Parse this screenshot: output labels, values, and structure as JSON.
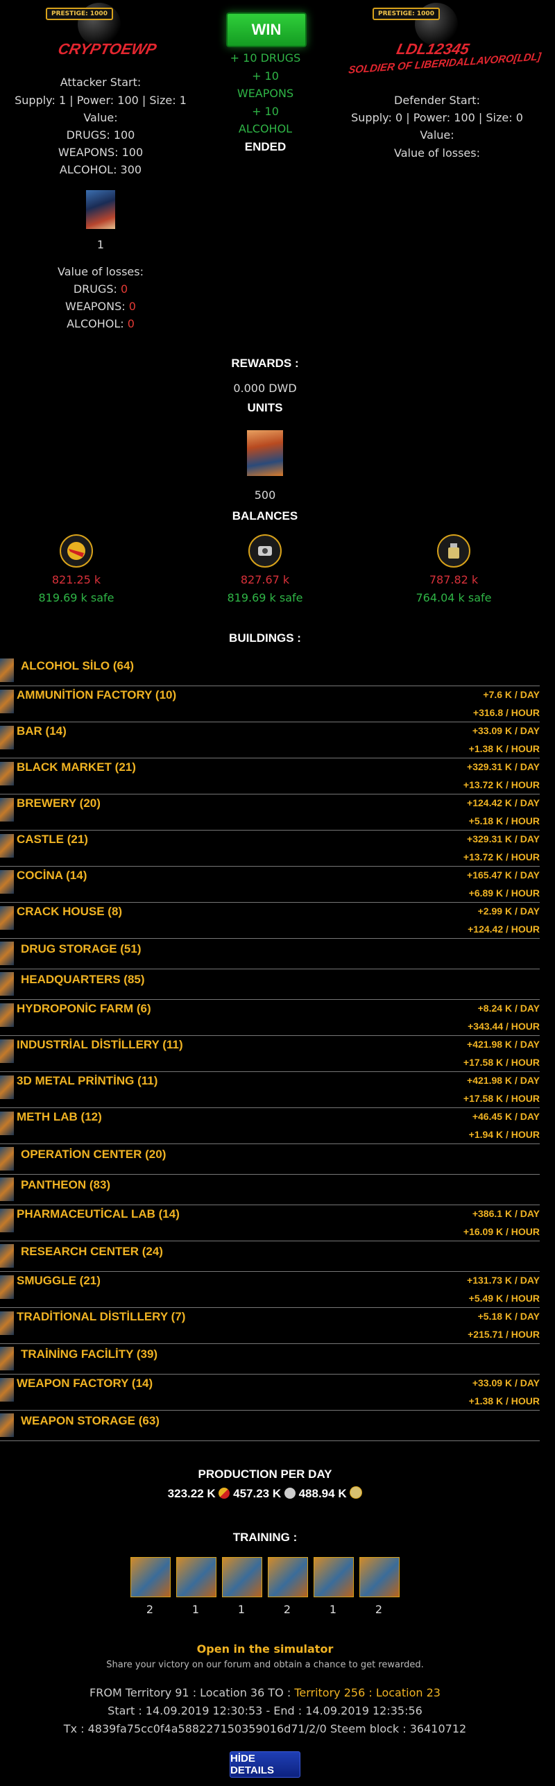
{
  "attacker": {
    "prestige": "PRESTIGE: 1000",
    "name": "CRYPTOEWP",
    "start_label": "Attacker Start:",
    "stats": "Supply: 1 | Power: 100 | Size: 1",
    "value_label": "Value:",
    "drugs": "DRUGS: 100",
    "weapons": "WEAPONS: 100",
    "alcohol": "ALCOHOL: 300",
    "unit_count": "1",
    "losses_label": "Value of losses:",
    "loss_drugs_label": "DRUGS:",
    "loss_drugs": "0",
    "loss_weapons_label": "WEAPONS:",
    "loss_weapons": "0",
    "loss_alcohol_label": "ALCOHOL:",
    "loss_alcohol": "0"
  },
  "result": {
    "win_label": "WIN",
    "line1": "+ 10 DRUGS",
    "line2": "+ 10",
    "line3": "WEAPONS",
    "line4": "+ 10",
    "line5": "ALCOHOL",
    "status": "ENDED"
  },
  "defender": {
    "prestige": "PRESTIGE: 1000",
    "name": "LDL12345",
    "subtitle": "SOLDIER OF LIBERIDALLAVORO[LDL]",
    "start_label": "Defender Start:",
    "stats": "Supply: 0 | Power: 100 | Size: 0",
    "value_label": "Value:",
    "losses_label": "Value of losses:"
  },
  "rewards": {
    "title": "REWARDS :",
    "dwd": "0.000 DWD",
    "units_title": "UNITS",
    "unit_count": "500",
    "balances_title": "BALANCES",
    "balances": [
      {
        "icon": "drugs-icon",
        "value": "821.25 k",
        "safe": "819.69 k safe"
      },
      {
        "icon": "weapons-icon",
        "value": "827.67 k",
        "safe": "819.69 k safe"
      },
      {
        "icon": "alcohol-icon",
        "value": "787.82 k",
        "safe": "764.04 k safe"
      }
    ]
  },
  "buildings": {
    "title": "BUILDINGS :",
    "items": [
      {
        "name": "ALCOHOL SİLO (64)",
        "day": "",
        "hour": ""
      },
      {
        "name": "AMMUNİTİON FACTORY (10)",
        "day": "+7.6 K / DAY",
        "hour": "+316.8 / HOUR"
      },
      {
        "name": "BAR (14)",
        "day": "+33.09 K / DAY",
        "hour": "+1.38 K / HOUR"
      },
      {
        "name": "BLACK MARKET (21)",
        "day": "+329.31 K / DAY",
        "hour": "+13.72 K / HOUR"
      },
      {
        "name": "BREWERY (20)",
        "day": "+124.42 K / DAY",
        "hour": "+5.18 K / HOUR"
      },
      {
        "name": "CASTLE (21)",
        "day": "+329.31 K / DAY",
        "hour": "+13.72 K / HOUR"
      },
      {
        "name": "COCİNA (14)",
        "day": "+165.47 K / DAY",
        "hour": "+6.89 K / HOUR"
      },
      {
        "name": "CRACK HOUSE (8)",
        "day": "+2.99 K / DAY",
        "hour": "+124.42 / HOUR"
      },
      {
        "name": "DRUG STORAGE (51)",
        "day": "",
        "hour": ""
      },
      {
        "name": "HEADQUARTERS (85)",
        "day": "",
        "hour": ""
      },
      {
        "name": "HYDROPONİC FARM (6)",
        "day": "+8.24 K / DAY",
        "hour": "+343.44 / HOUR"
      },
      {
        "name": "INDUSTRİAL DİSTİLLERY (11)",
        "day": "+421.98 K / DAY",
        "hour": "+17.58 K / HOUR"
      },
      {
        "name": "3D METAL PRİNTİNG (11)",
        "day": "+421.98 K / DAY",
        "hour": "+17.58 K / HOUR"
      },
      {
        "name": "METH LAB (12)",
        "day": "+46.45 K / DAY",
        "hour": "+1.94 K / HOUR"
      },
      {
        "name": "OPERATİON CENTER (20)",
        "day": "",
        "hour": ""
      },
      {
        "name": "PANTHEON (83)",
        "day": "",
        "hour": ""
      },
      {
        "name": "PHARMACEUTİCAL LAB (14)",
        "day": "+386.1 K / DAY",
        "hour": "+16.09 K / HOUR"
      },
      {
        "name": "RESEARCH CENTER (24)",
        "day": "",
        "hour": ""
      },
      {
        "name": "SMUGGLE (21)",
        "day": "+131.73 K / DAY",
        "hour": "+5.49 K / HOUR"
      },
      {
        "name": "TRADİTİONAL DİSTİLLERY (7)",
        "day": "+5.18 K / DAY",
        "hour": "+215.71 / HOUR"
      },
      {
        "name": "TRAİNİNG FACİLİTY (39)",
        "day": "",
        "hour": ""
      },
      {
        "name": "WEAPON FACTORY (14)",
        "day": "+33.09 K / DAY",
        "hour": "+1.38 K / HOUR"
      },
      {
        "name": "WEAPON STORAGE (63)",
        "day": "",
        "hour": ""
      }
    ]
  },
  "production": {
    "title": "PRODUCTION PER DAY",
    "drugs": "323.22 K",
    "weapons": "457.23 K",
    "alcohol": "488.94 K"
  },
  "training": {
    "title": "TRAINING :",
    "counts": [
      "2",
      "1",
      "1",
      "2",
      "1",
      "2"
    ]
  },
  "footer": {
    "simulator_link": "Open in the simulator",
    "share_text": "Share your victory on our forum and obtain a chance to get rewarded.",
    "from_text": "FROM Territory 91 : Location 36 TO :",
    "to_text": "Territory 256 : Location 23",
    "times": "Start : 14.09.2019 12:30:53 - End : 14.09.2019 12:35:56",
    "tx": "Tx : 4839fa75cc0f4a588227150359016d71/2/0 Steem block : 36410712",
    "hide_button": "HİDE DETAILS"
  }
}
